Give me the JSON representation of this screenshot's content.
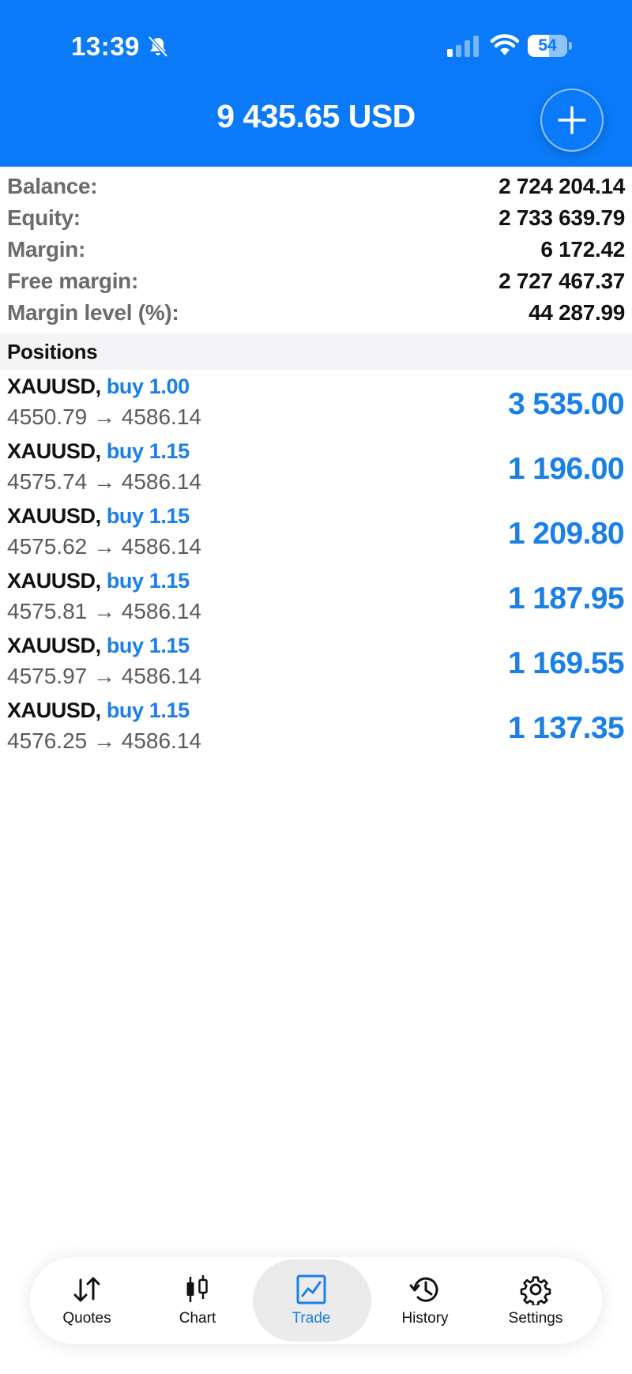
{
  "status_bar": {
    "time": "13:39",
    "battery": "54",
    "battery_level": 0.54
  },
  "header": {
    "title": "9 435.65 USD",
    "add_icon": "plus-icon"
  },
  "summary": [
    {
      "label": "Balance:",
      "value": "2 724 204.14"
    },
    {
      "label": "Equity:",
      "value": "2 733 639.79"
    },
    {
      "label": "Margin:",
      "value": "6 172.42"
    },
    {
      "label": "Free margin:",
      "value": "2 727 467.37"
    },
    {
      "label": "Margin level (%):",
      "value": "44 287.99"
    }
  ],
  "positions_title": "Positions",
  "positions": [
    {
      "symbol": "XAUUSD,",
      "side": "buy 1.00",
      "prices": "4550.79 → 4586.14",
      "profit": "3 535.00"
    },
    {
      "symbol": "XAUUSD,",
      "side": "buy 1.15",
      "prices": "4575.74 → 4586.14",
      "profit": "1 196.00"
    },
    {
      "symbol": "XAUUSD,",
      "side": "buy 1.15",
      "prices": "4575.62 → 4586.14",
      "profit": "1 209.80"
    },
    {
      "symbol": "XAUUSD,",
      "side": "buy 1.15",
      "prices": "4575.81 → 4586.14",
      "profit": "1 187.95"
    },
    {
      "symbol": "XAUUSD,",
      "side": "buy 1.15",
      "prices": "4575.97 → 4586.14",
      "profit": "1 169.55"
    },
    {
      "symbol": "XAUUSD,",
      "side": "buy 1.15",
      "prices": "4576.25 → 4586.14",
      "profit": "1 137.35"
    }
  ],
  "tabs": [
    {
      "label": "Quotes",
      "icon": "quotes-arrows-icon"
    },
    {
      "label": "Chart",
      "icon": "candlestick-icon"
    },
    {
      "label": "Trade",
      "icon": "trade-chart-icon",
      "active": true
    },
    {
      "label": "History",
      "icon": "history-clock-icon"
    },
    {
      "label": "Settings",
      "icon": "gear-icon"
    }
  ],
  "colors": {
    "brand_blue": "#0a7af9",
    "profit_blue": "#1a7fe6"
  }
}
